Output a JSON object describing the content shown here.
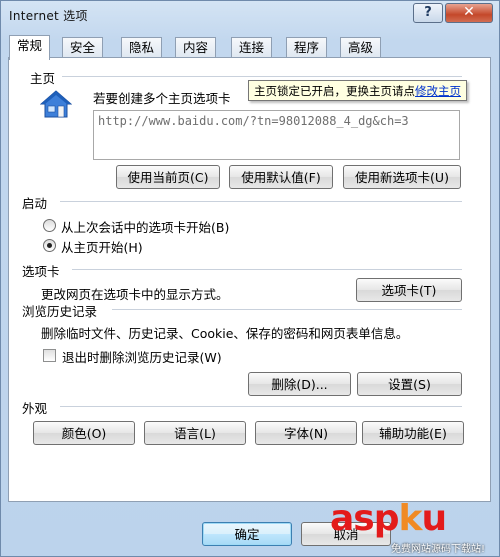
{
  "window": {
    "title": "Internet 选项",
    "help": "?",
    "close": "✕"
  },
  "tabs": [
    "常规",
    "安全",
    "隐私",
    "内容",
    "连接",
    "程序",
    "高级"
  ],
  "homepage": {
    "section": "主页",
    "prompt": "若要创建多个主页选项卡",
    "url": "http://www.baidu.com/?tn=98012088_4_dg&ch=3",
    "tooltip_text": "主页锁定已开启，更换主页请点",
    "tooltip_link": "修改主页",
    "buttons": [
      "使用当前页(C)",
      "使用默认值(F)",
      "使用新选项卡(U)"
    ]
  },
  "startup": {
    "section": "启动",
    "options": [
      {
        "label": "从上次会话中的选项卡开始(B)",
        "checked": false
      },
      {
        "label": "从主页开始(H)",
        "checked": true
      }
    ]
  },
  "tabs_section": {
    "section": "选项卡",
    "desc": "更改网页在选项卡中的显示方式。",
    "button": "选项卡(T)"
  },
  "history": {
    "section": "浏览历史记录",
    "desc": "删除临时文件、历史记录、Cookie、保存的密码和网页表单信息。",
    "checkbox": "退出时删除浏览历史记录(W)",
    "checked": false,
    "delete_button": "删除(D)...",
    "settings_button": "设置(S)"
  },
  "appearance": {
    "section": "外观",
    "buttons": [
      "颜色(O)",
      "语言(L)",
      "字体(N)",
      "辅助功能(E)"
    ]
  },
  "footer": {
    "ok": "确定",
    "cancel": "取消"
  },
  "watermark": {
    "brand_a": "asp",
    "brand_k": "k",
    "brand_u": "u",
    "tagline": "免费网站源码下载站!"
  }
}
